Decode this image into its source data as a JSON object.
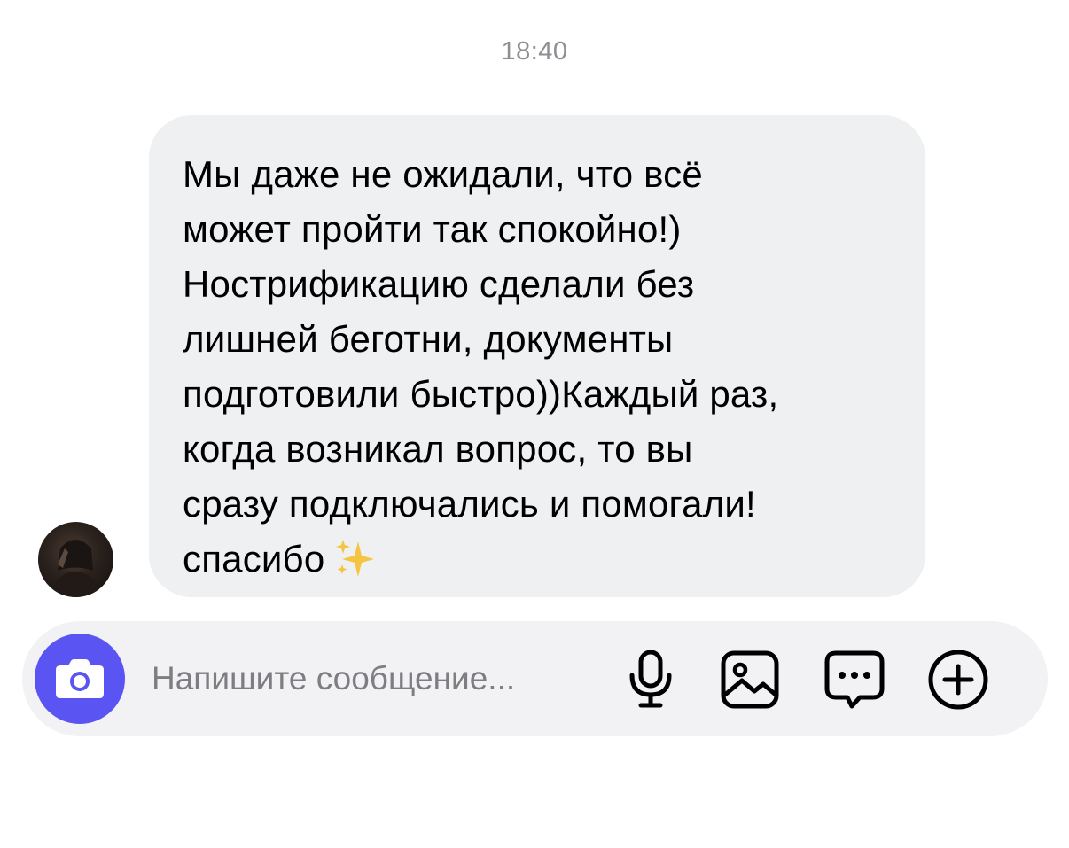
{
  "chat": {
    "timestamp": "18:40",
    "message": {
      "text": "Мы даже не ожидали, что всё\nможет пройти так спокойно!)\nНострификацию сделали без\nлишней беготни, документы\nподготовили быстро))Каждый раз,\nкогда возникал вопрос, то вы\nсразу подключались и помогали!\nспасибо",
      "emoji": "sparkles-icon"
    },
    "sender_avatar": "avatar"
  },
  "composer": {
    "placeholder": "Напишите сообщение...",
    "value": "",
    "buttons": {
      "camera": "camera-icon",
      "mic": "microphone-icon",
      "gallery": "image-icon",
      "sticker": "message-dots-icon",
      "add": "plus-circle-icon"
    }
  },
  "colors": {
    "accent": "#5a55f2",
    "bubble": "#eff0f2",
    "composer_bg": "#f2f2f4",
    "timestamp": "#8e8e93",
    "placeholder": "#7d7d82",
    "sparkles": "#f5c542"
  }
}
